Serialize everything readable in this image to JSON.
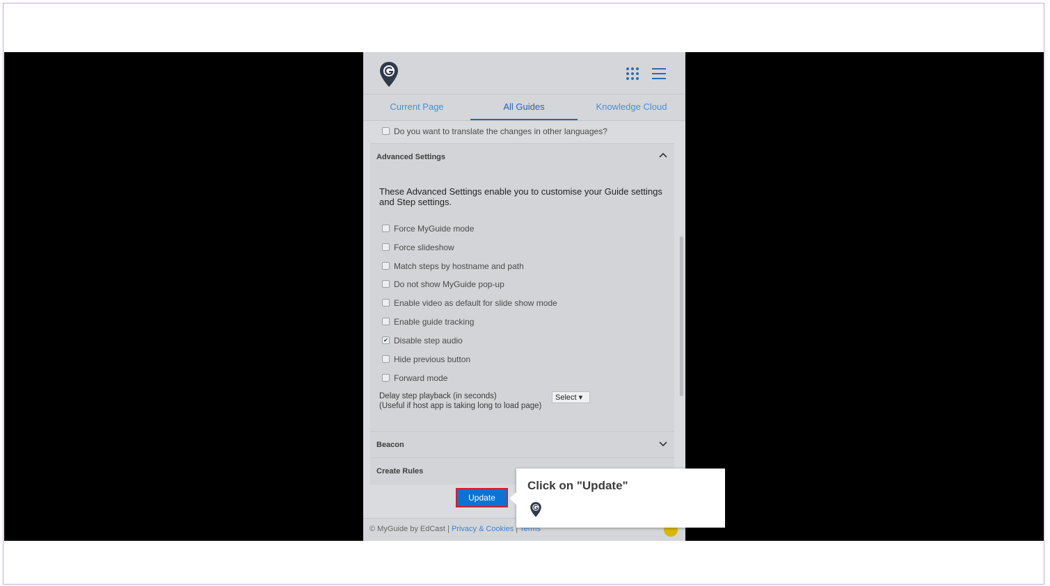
{
  "tabs": [
    {
      "label": "Current Page"
    },
    {
      "label": "All Guides"
    },
    {
      "label": "Knowledge Cloud"
    }
  ],
  "translate_checkbox": {
    "label": "Do you want to translate the changes in other languages?",
    "checked": false
  },
  "advanced": {
    "title": "Advanced Settings",
    "description": "These Advanced Settings enable you to customise your Guide settings and Step settings.",
    "options": [
      {
        "label": "Force MyGuide mode",
        "checked": false
      },
      {
        "label": "Force slideshow",
        "checked": false
      },
      {
        "label": "Match steps by hostname and path",
        "checked": false
      },
      {
        "label": "Do not show MyGuide pop-up",
        "checked": false
      },
      {
        "label": "Enable video as default for slide show mode",
        "checked": false
      },
      {
        "label": "Enable guide tracking",
        "checked": false
      },
      {
        "label": "Disable step audio",
        "checked": true
      },
      {
        "label": "Hide previous button",
        "checked": false
      },
      {
        "label": "Forward mode",
        "checked": false
      }
    ],
    "delay_label_line1": "Delay step playback (in seconds)",
    "delay_label_line2": "(Useful if host app is taking long to load page)",
    "delay_select": "Select"
  },
  "beacon": {
    "title": "Beacon"
  },
  "create_rules": {
    "title": "Create Rules"
  },
  "update_button": "Update",
  "footer": {
    "copyright": "© MyGuide by EdCast",
    "privacy": "Privacy & Cookies",
    "terms": "Terms"
  },
  "tooltip": {
    "text": "Click on \"Update\""
  },
  "colors": {
    "primary": "#0a74d6",
    "highlight": "#d81b2b",
    "tab_active": "#2763b1"
  }
}
